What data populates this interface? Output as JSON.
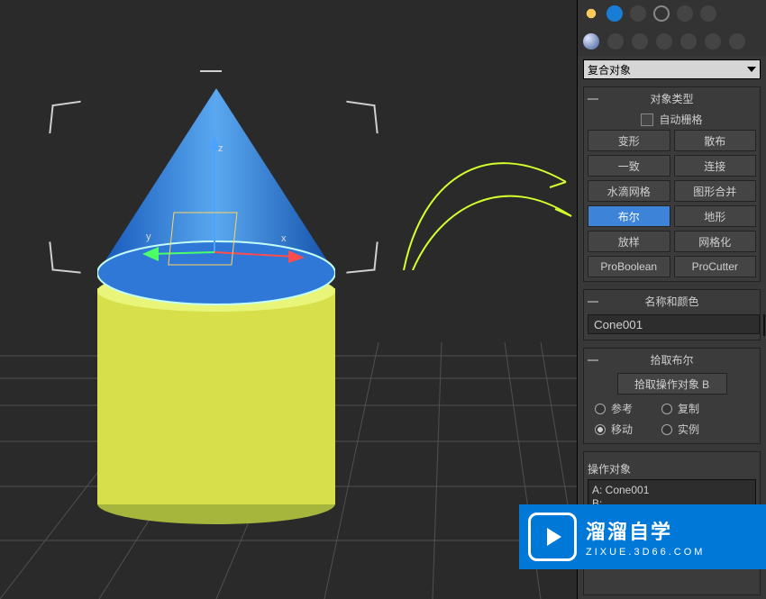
{
  "top_tabs": {
    "sun": "sun-icon",
    "arc": "arc-icon",
    "hier": "hierarchy-icon",
    "motion": "motion-icon",
    "display": "display-icon",
    "util": "utilities-icon"
  },
  "sub_icons": {
    "sphere": "sphere-icon",
    "a": "a",
    "b": "b",
    "c": "c",
    "d": "d",
    "e": "e",
    "f": "f"
  },
  "dropdown": {
    "label": "复合对象"
  },
  "object_type": {
    "title": "对象类型",
    "autogrid": "自动栅格",
    "buttons": [
      {
        "label": "变形",
        "sel": false
      },
      {
        "label": "散布",
        "sel": false
      },
      {
        "label": "一致",
        "sel": false
      },
      {
        "label": "连接",
        "sel": false
      },
      {
        "label": "水滴网格",
        "sel": false
      },
      {
        "label": "图形合并",
        "sel": false
      },
      {
        "label": "布尔",
        "sel": true
      },
      {
        "label": "地形",
        "sel": false
      },
      {
        "label": "放样",
        "sel": false
      },
      {
        "label": "网格化",
        "sel": false
      },
      {
        "label": "ProBoolean",
        "sel": false
      },
      {
        "label": "ProCutter",
        "sel": false
      }
    ]
  },
  "name_color": {
    "title": "名称和颜色",
    "value": "Cone001"
  },
  "pick_bool": {
    "title": "拾取布尔",
    "pick_btn": "拾取操作对象 B",
    "radios_top": [
      {
        "label": "参考",
        "sel": false
      },
      {
        "label": "复制",
        "sel": false
      }
    ],
    "radios_bot": [
      {
        "label": "移动",
        "sel": true
      },
      {
        "label": "实例",
        "sel": false
      }
    ]
  },
  "operands": {
    "title": "操作对象",
    "list": [
      "A: Cone001",
      "B:"
    ]
  },
  "axes": {
    "z": "z",
    "x": "x",
    "y": "y"
  },
  "watermark": {
    "big": "溜溜自学",
    "small": "ZIXUE.3D66.COM"
  }
}
